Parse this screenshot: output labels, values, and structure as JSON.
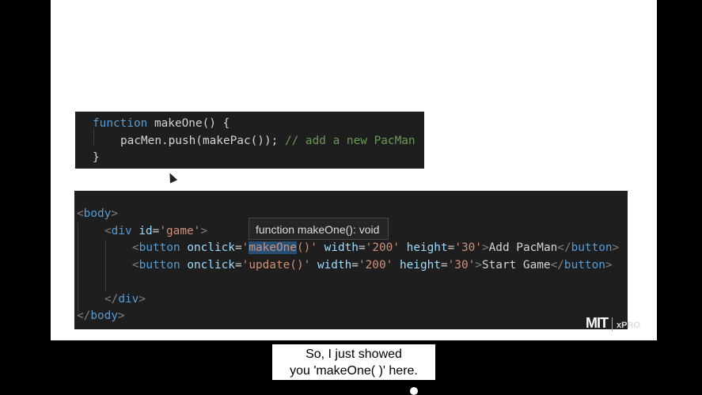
{
  "code_snippet_js": {
    "lines": [
      {
        "kw": "function",
        "rest": " makeOne() {"
      },
      {
        "code": "pacMen.push(makePac());",
        "comment": " // add a new PacMan"
      },
      {
        "code": "}"
      }
    ]
  },
  "code_snippet_html": {
    "body_open": "body",
    "div_tag": "div",
    "id_attr": "id",
    "id_value": "'game'",
    "button_tag": "button",
    "onclick_attr": "onclick",
    "width_attr": "width",
    "height_attr": "height",
    "btn1": {
      "onclick_q1": "'",
      "onclick_fn": "makeOne",
      "onclick_rest": "()'",
      "width": "'200'",
      "height": "'30'",
      "text": "Add PacMan"
    },
    "btn2": {
      "onclick": "'update()'",
      "width": "'200'",
      "height": "'30'",
      "text": "Start Game"
    }
  },
  "tooltip": {
    "text": "function makeOne(): void"
  },
  "logo": {
    "mit": "MIT",
    "xpro": "xPRO"
  },
  "caption": {
    "line1": "So, I just showed",
    "line2": "you 'makeOne( )' here."
  }
}
